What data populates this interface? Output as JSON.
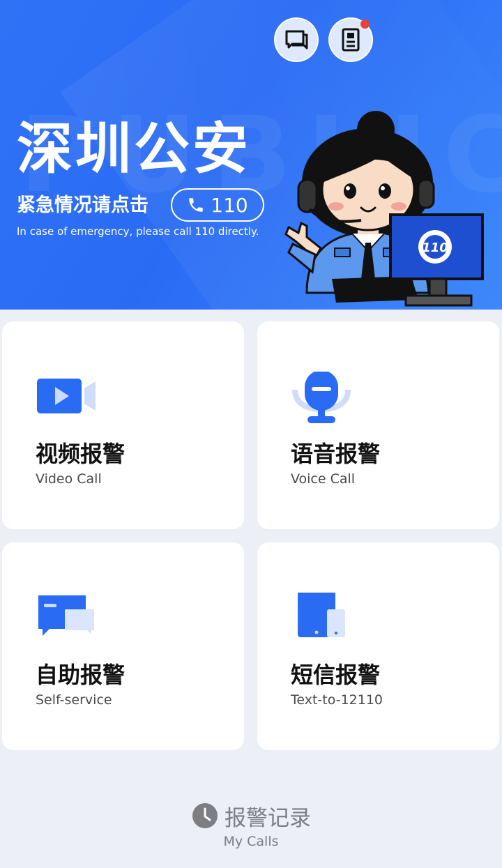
{
  "header": {
    "title": "深圳公安",
    "watermark": "PUBLIC",
    "emergency_prompt": "紧急情况请点击",
    "call_button_label": "110",
    "emergency_english": "In case of emergency, please call 110 directly.",
    "monitor_logo_text": "110"
  },
  "top_icons": {
    "messages": "chat-icon",
    "records": "document-icon",
    "records_has_notification": true
  },
  "cards": [
    {
      "title": "视频报警",
      "subtitle": "Video Call",
      "icon": "video-camera-icon"
    },
    {
      "title": "语音报警",
      "subtitle": "Voice Call",
      "icon": "microphone-icon"
    },
    {
      "title": "自助报警",
      "subtitle": "Self-service",
      "icon": "chat-bubbles-icon"
    },
    {
      "title": "短信报警",
      "subtitle": "Text-to-12110",
      "icon": "mobile-tablet-icon"
    }
  ],
  "records": {
    "title": "报警记录",
    "subtitle": "My Calls",
    "icon": "clock-icon"
  },
  "colors": {
    "brand_blue": "#2f72f6",
    "page_background": "#eceff6",
    "notification_red": "#e8413a",
    "muted_text": "#7d7d82"
  }
}
